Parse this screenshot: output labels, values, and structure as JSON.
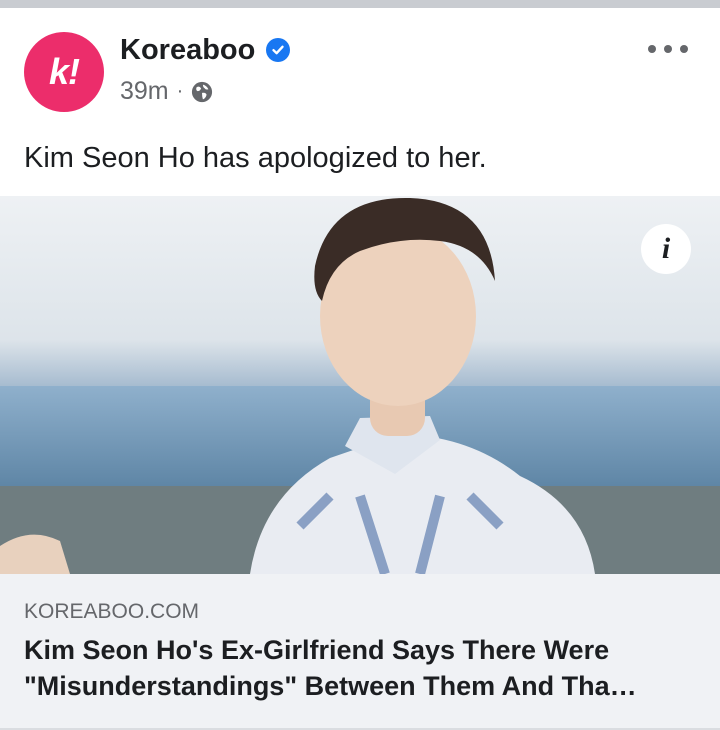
{
  "post": {
    "page_name": "Koreaboo",
    "time": "39m",
    "separator": "·",
    "caption": "Kim Seon Ho has apologized to her.",
    "avatar_initial": "k!",
    "verified": true,
    "audience_icon": "globe-icon"
  },
  "link": {
    "domain": "KOREABOO.COM",
    "title": "Kim Seon Ho's Ex-Girlfriend Says There Were \"Misunderstandings\" Between Them And Tha…"
  },
  "image": {
    "info_label": "i"
  },
  "colors": {
    "brand": "#ec2d6b",
    "verified": "#1877f2",
    "text": "#1c1e21",
    "secondary": "#65676b",
    "preview_bg": "#f0f2f5"
  }
}
